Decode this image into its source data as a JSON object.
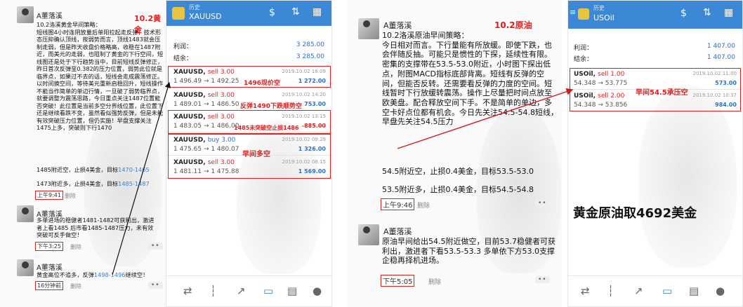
{
  "left_chat": {
    "post1": {
      "author": "A董落溪",
      "header_tag": "10.2黄金",
      "text": "10.2洛溪黄金早间策略：\n短线图4小时连阴放量后单阳拉起走反弹，技术形态压抑确认顶线，按弱势而言，顶线1483就会压制走弱，但是昨天收盘价格略高，收稳在1487附近，而美元的走弱，也阻制了黄金的下行空间，短线图还是处于下行趋势当中，目前短线反弹修正，昨日首次反弹至0.382的压力位置，弱势此位就是临界点，如果过不去的话，短线会走成震荡修正。以时间换空间，等待美元重新启稳回升，短线操作不能当作简单的单边行情，一旦破了弱势临界点，就要调整为震荡思路，今日重点关注1487位置能否突破！此位置是当前多空分界线位置，此位置下还是继续看跌不变，虽然看似强势反弹，但是未能有效突破压力位置，但仍实施！早盘支撑关注1475上多，突破则下行1470",
      "tail_link": "1475",
      "line1_pre": "1485附近空，止损4美金，目标",
      "line1_link": "1470-1465",
      "line2_pre": "1473附近多，止损4美金，目标",
      "line2_link": "1485-1487",
      "time": "上午9:41",
      "delete": "删除"
    },
    "post2": {
      "author": "A董落溪",
      "text": "多单进场的稳健者1481-1482可获利出，激进者上看1485 后市看1485-1487压力，未有效突破可反手做空！",
      "time": "下午3:25",
      "delete": "删除",
      "more": "••"
    },
    "post3": {
      "author": "A董落溪",
      "text_pre": "黄金高位不追多，反弹",
      "text_link": "1498-1496",
      "text_post": "继续空！",
      "time": "16分钟前",
      "delete": "删除",
      "more": "••"
    }
  },
  "xau_app": {
    "header_small": "历史",
    "header_title": "XAUUSD",
    "profit_label": "利润：",
    "profit_value": "3 285.00",
    "balance_label": "结余：",
    "balance_value": "3 285.00",
    "orders": [
      {
        "symbol": "XAUUSD,",
        "type": "sell 3.00",
        "price": "1 496.49 → 1 492.25",
        "date": "2019.10.02 16:09",
        "pl": "1 272.00",
        "annotation": "1496现价空"
      },
      {
        "symbol": "XAUUSD,",
        "type": "sell 3.00",
        "price": "1 489.01 → 1 486.50",
        "date": "2019.10.02 14:20",
        "pl": "753.00",
        "annotation": "反弹1490下跌顺势空"
      },
      {
        "symbol": "XAUUSD,",
        "type": "sell 3.00",
        "price": "1 483.05 → 1 486.00",
        "date": "2019.10.02 13:15",
        "pl": "-885.00",
        "annotation": "1485未突破空止损1486"
      },
      {
        "symbol": "XAUUSD,",
        "type": "buy 3.00",
        "price": "1 475.65 → 1 480.07",
        "date": "2019.10.02 09:29",
        "pl": "1 326.00",
        "annotation": "早间多空"
      },
      {
        "symbol": "XAUUSD,",
        "type": "sell 3.00",
        "price": "1 481.11 → 1 475.88",
        "date": "2019.10.02 08:15",
        "pl": "1 569.00",
        "annotation": ""
      }
    ]
  },
  "right_chat": {
    "post1": {
      "author": "A董落溪",
      "header_tag": "10.2原油",
      "text": "10.2洛溪原油早间策略：\n今日相对而言。下行量能有所放缓。即使下跌，也会伴随反抽。可能只是惯性的下探，延续性有限。密集的支撑带在53.5-53.0附近，小时图下探出低点，附图MACD指标底部背离。短线有反弹的空间，但能否反转。还需要看反弹的力度的空间。短线暂时下行放缓转震荡。操作上尽量把时间点放至欧美盘。配合释放空间下手。不是简单的单边，多空卡好点位都有机会。今日先关注54.5-54.8短线，早盘先关注54.5压力",
      "line1": "54.5附近空，止损0.4美金，目标53.5-53.0",
      "line2": "53.5附近多，止损0.4美金，目标54.5-54.8",
      "time": "上午9:46",
      "delete": "删除",
      "more": "••"
    },
    "post2": {
      "author": "A董落溪",
      "text": "原油早间给出54.5附近做空，目前53.7稳健者可获利出，激进者下看53.5-53.3 多单依下方53.0支撑企稳再择机进场。",
      "time": "下午5:05",
      "delete": "删除",
      "more": "••"
    }
  },
  "oil_app": {
    "header_small": "历史",
    "header_title": "USOil",
    "profit_label": "利润：",
    "profit_value": "1 407.00",
    "balance_label": "结余：",
    "balance_value": "1 407.00",
    "orders": [
      {
        "symbol": "USOil,",
        "type": "sell 1.00",
        "price": "54.348 → 53.775",
        "date": "2019.10.02 11:00",
        "pl": "573.00"
      },
      {
        "symbol": "USOil,",
        "type": "sell 2.00",
        "price": "54.348 → 53.856",
        "date": "2019.10.02 10:37",
        "pl": "984.00"
      }
    ],
    "annotation": "早间54.5承压空"
  },
  "banner": "黄金原油取4692美金",
  "colors": {
    "accent": "#3b88d6",
    "annotation": "#e02020",
    "link": "#3a7fd5",
    "loss": "#e02020",
    "profit": "#2a6fcc"
  }
}
